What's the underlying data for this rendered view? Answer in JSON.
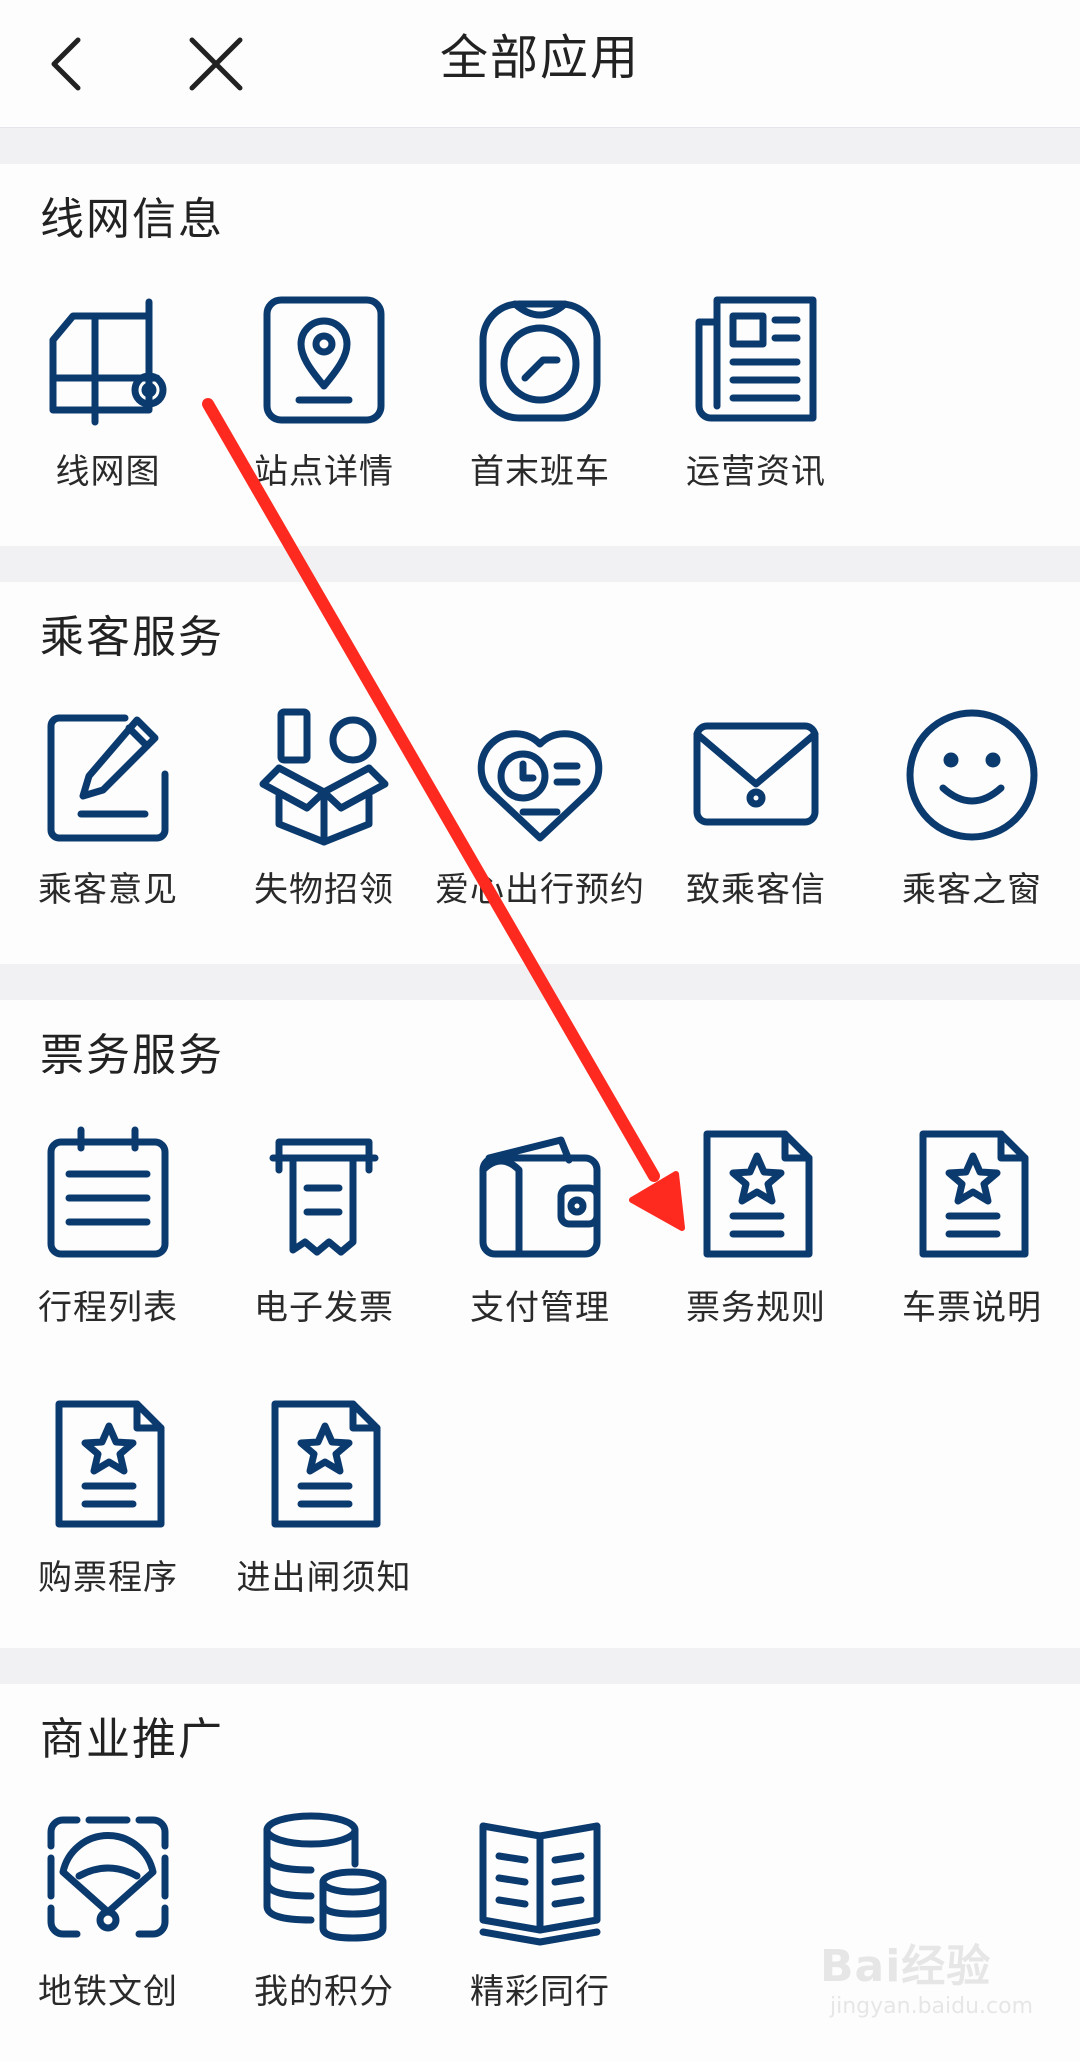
{
  "header": {
    "title": "全部应用"
  },
  "sections": [
    {
      "title": "线网信息",
      "items": [
        {
          "label": "线网图",
          "icon": "network-map-icon"
        },
        {
          "label": "站点详情",
          "icon": "station-location-icon"
        },
        {
          "label": "首末班车",
          "icon": "clock-icon"
        },
        {
          "label": "运营资讯",
          "icon": "newspaper-icon"
        }
      ]
    },
    {
      "title": "乘客服务",
      "items": [
        {
          "label": "乘客意见",
          "icon": "edit-note-icon"
        },
        {
          "label": "失物招领",
          "icon": "lost-found-box-icon"
        },
        {
          "label": "爱心出行预约",
          "icon": "heart-clock-icon"
        },
        {
          "label": "致乘客信",
          "icon": "envelope-icon"
        },
        {
          "label": "乘客之窗",
          "icon": "smiley-icon"
        }
      ]
    },
    {
      "title": "票务服务",
      "items": [
        {
          "label": "行程列表",
          "icon": "calendar-list-icon"
        },
        {
          "label": "电子发票",
          "icon": "receipt-icon"
        },
        {
          "label": "支付管理",
          "icon": "wallet-icon"
        },
        {
          "label": "票务规则",
          "icon": "star-document-icon"
        },
        {
          "label": "车票说明",
          "icon": "star-document-icon"
        },
        {
          "label": "购票程序",
          "icon": "star-document-icon"
        },
        {
          "label": "进出闸须知",
          "icon": "star-document-icon"
        }
      ]
    },
    {
      "title": "商业推广",
      "items": [
        {
          "label": "地铁文创",
          "icon": "fan-icon"
        },
        {
          "label": "我的积分",
          "icon": "coin-stack-icon"
        },
        {
          "label": "精彩同行",
          "icon": "open-book-icon"
        }
      ]
    }
  ],
  "colors": {
    "icon": "#0b3a6e",
    "arrow": "#ff2a1f",
    "background": "#f1f1f4",
    "surface": "#fdfdfd"
  },
  "watermark": {
    "brand": "Bai经验",
    "url": "jingyan.baidu.com"
  }
}
